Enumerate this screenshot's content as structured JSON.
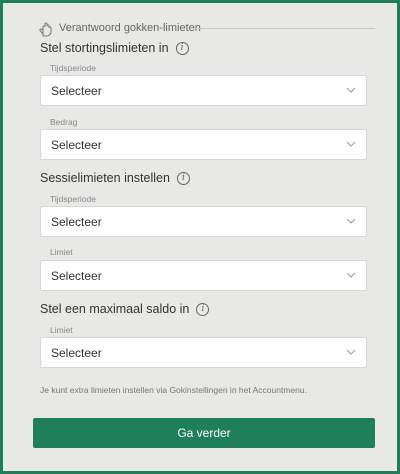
{
  "header": {
    "title": "Verantwoord gokken-limieten",
    "icon": "hand-icon"
  },
  "deposit": {
    "title": "Stel stortingslimieten in",
    "period": {
      "label": "Tijdsperiode",
      "value": "Selecteer"
    },
    "amount": {
      "label": "Bedrag",
      "value": "Selecteer"
    }
  },
  "session": {
    "title": "Sessielimieten instellen",
    "period": {
      "label": "Tijdsperiode",
      "value": "Selecteer"
    },
    "limit": {
      "label": "Limiet",
      "value": "Selecteer"
    }
  },
  "balance": {
    "title": "Stel een maximaal saldo in",
    "limit": {
      "label": "Limiet",
      "value": "Selecteer"
    }
  },
  "note": "Je kunt extra limieten instellen via Gokinstellingen in het Accountmenu.",
  "submit_label": "Ga verder",
  "colors": {
    "accent": "#1f7f5c",
    "background": "#e8e8e7"
  }
}
